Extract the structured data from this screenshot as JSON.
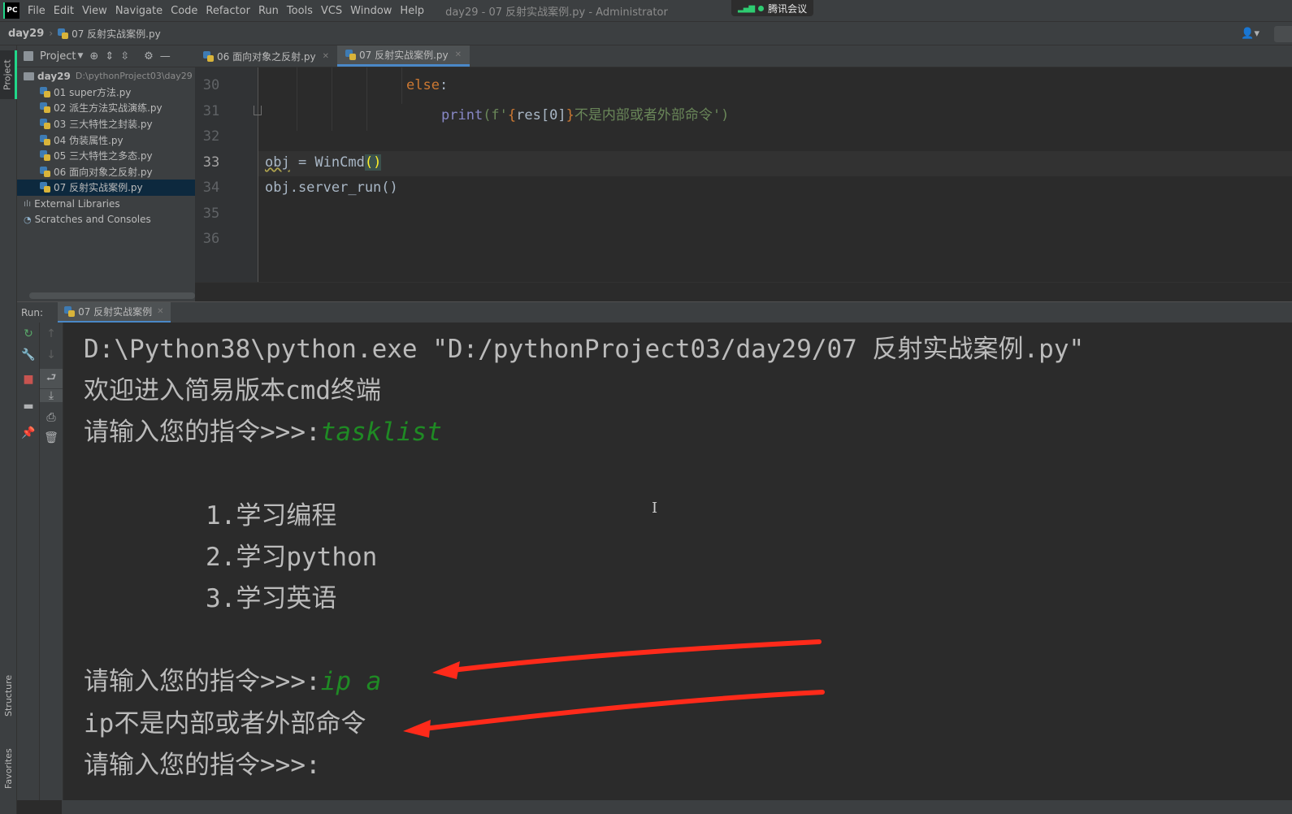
{
  "menubar": {
    "logo": "PC",
    "items": [
      "File",
      "Edit",
      "View",
      "Navigate",
      "Code",
      "Refactor",
      "Run",
      "Tools",
      "VCS",
      "Window",
      "Help"
    ],
    "window_title": "day29 - 07 反射实战案例.py - Administrator",
    "meeting_label": "腾讯会议"
  },
  "navbar": {
    "root": "day29",
    "file": "07 反射实战案例.py"
  },
  "left_strip": {
    "project_tab": "Project",
    "structure_tab": "Structure",
    "favorites_tab": "Favorites"
  },
  "project": {
    "title": "Project",
    "root_name": "day29",
    "root_path": "D:\\pythonProject03\\day29",
    "files": [
      "01 super方法.py",
      "02 派生方法实战演练.py",
      "03 三大特性之封装.py",
      "04 伪装属性.py",
      "05 三大特性之多态.py",
      "06 面向对象之反射.py",
      "07 反射实战案例.py"
    ],
    "external_libraries": "External Libraries",
    "scratches": "Scratches and Consoles"
  },
  "editor_tabs": [
    {
      "label": "06 面向对象之反射.py",
      "active": false
    },
    {
      "label": "07 反射实战案例.py",
      "active": true
    }
  ],
  "editor": {
    "line_numbers": [
      "30",
      "31",
      "32",
      "33",
      "34",
      "35",
      "36"
    ],
    "current_line": "33",
    "code": {
      "l30_else": "else",
      "l30_colon": ":",
      "l31_print": "print",
      "l31_open": "(f'",
      "l31_brace_open": "{",
      "l31_expr": "res[0]",
      "l31_brace_close": "}",
      "l31_text": "不是内部或者外部命令",
      "l31_close": "')",
      "l33_obj": "obj",
      "l33_eq": " = WinCmd",
      "l33_parens": "()",
      "l34": "obj.server_run()"
    }
  },
  "run_panel": {
    "label": "Run:",
    "tab": "07 反射实战案例"
  },
  "console": {
    "cmd": "D:\\Python38\\python.exe \"D:/pythonProject03/day29/07 反射实战案例.py\"",
    "welcome": "欢迎进入简易版本cmd终端",
    "prompt": "请输入您的指令>>>:",
    "input1": "tasklist",
    "item1": "1.学习编程",
    "item2": "2.学习python",
    "item3": "3.学习英语",
    "input2": "ip a",
    "error": "ip不是内部或者外部命令"
  },
  "colors": {
    "accent_green": "#21d789",
    "selection": "#0d293e",
    "user_input": "#1f8a24",
    "annotation_arrow": "#ff2a1a"
  }
}
